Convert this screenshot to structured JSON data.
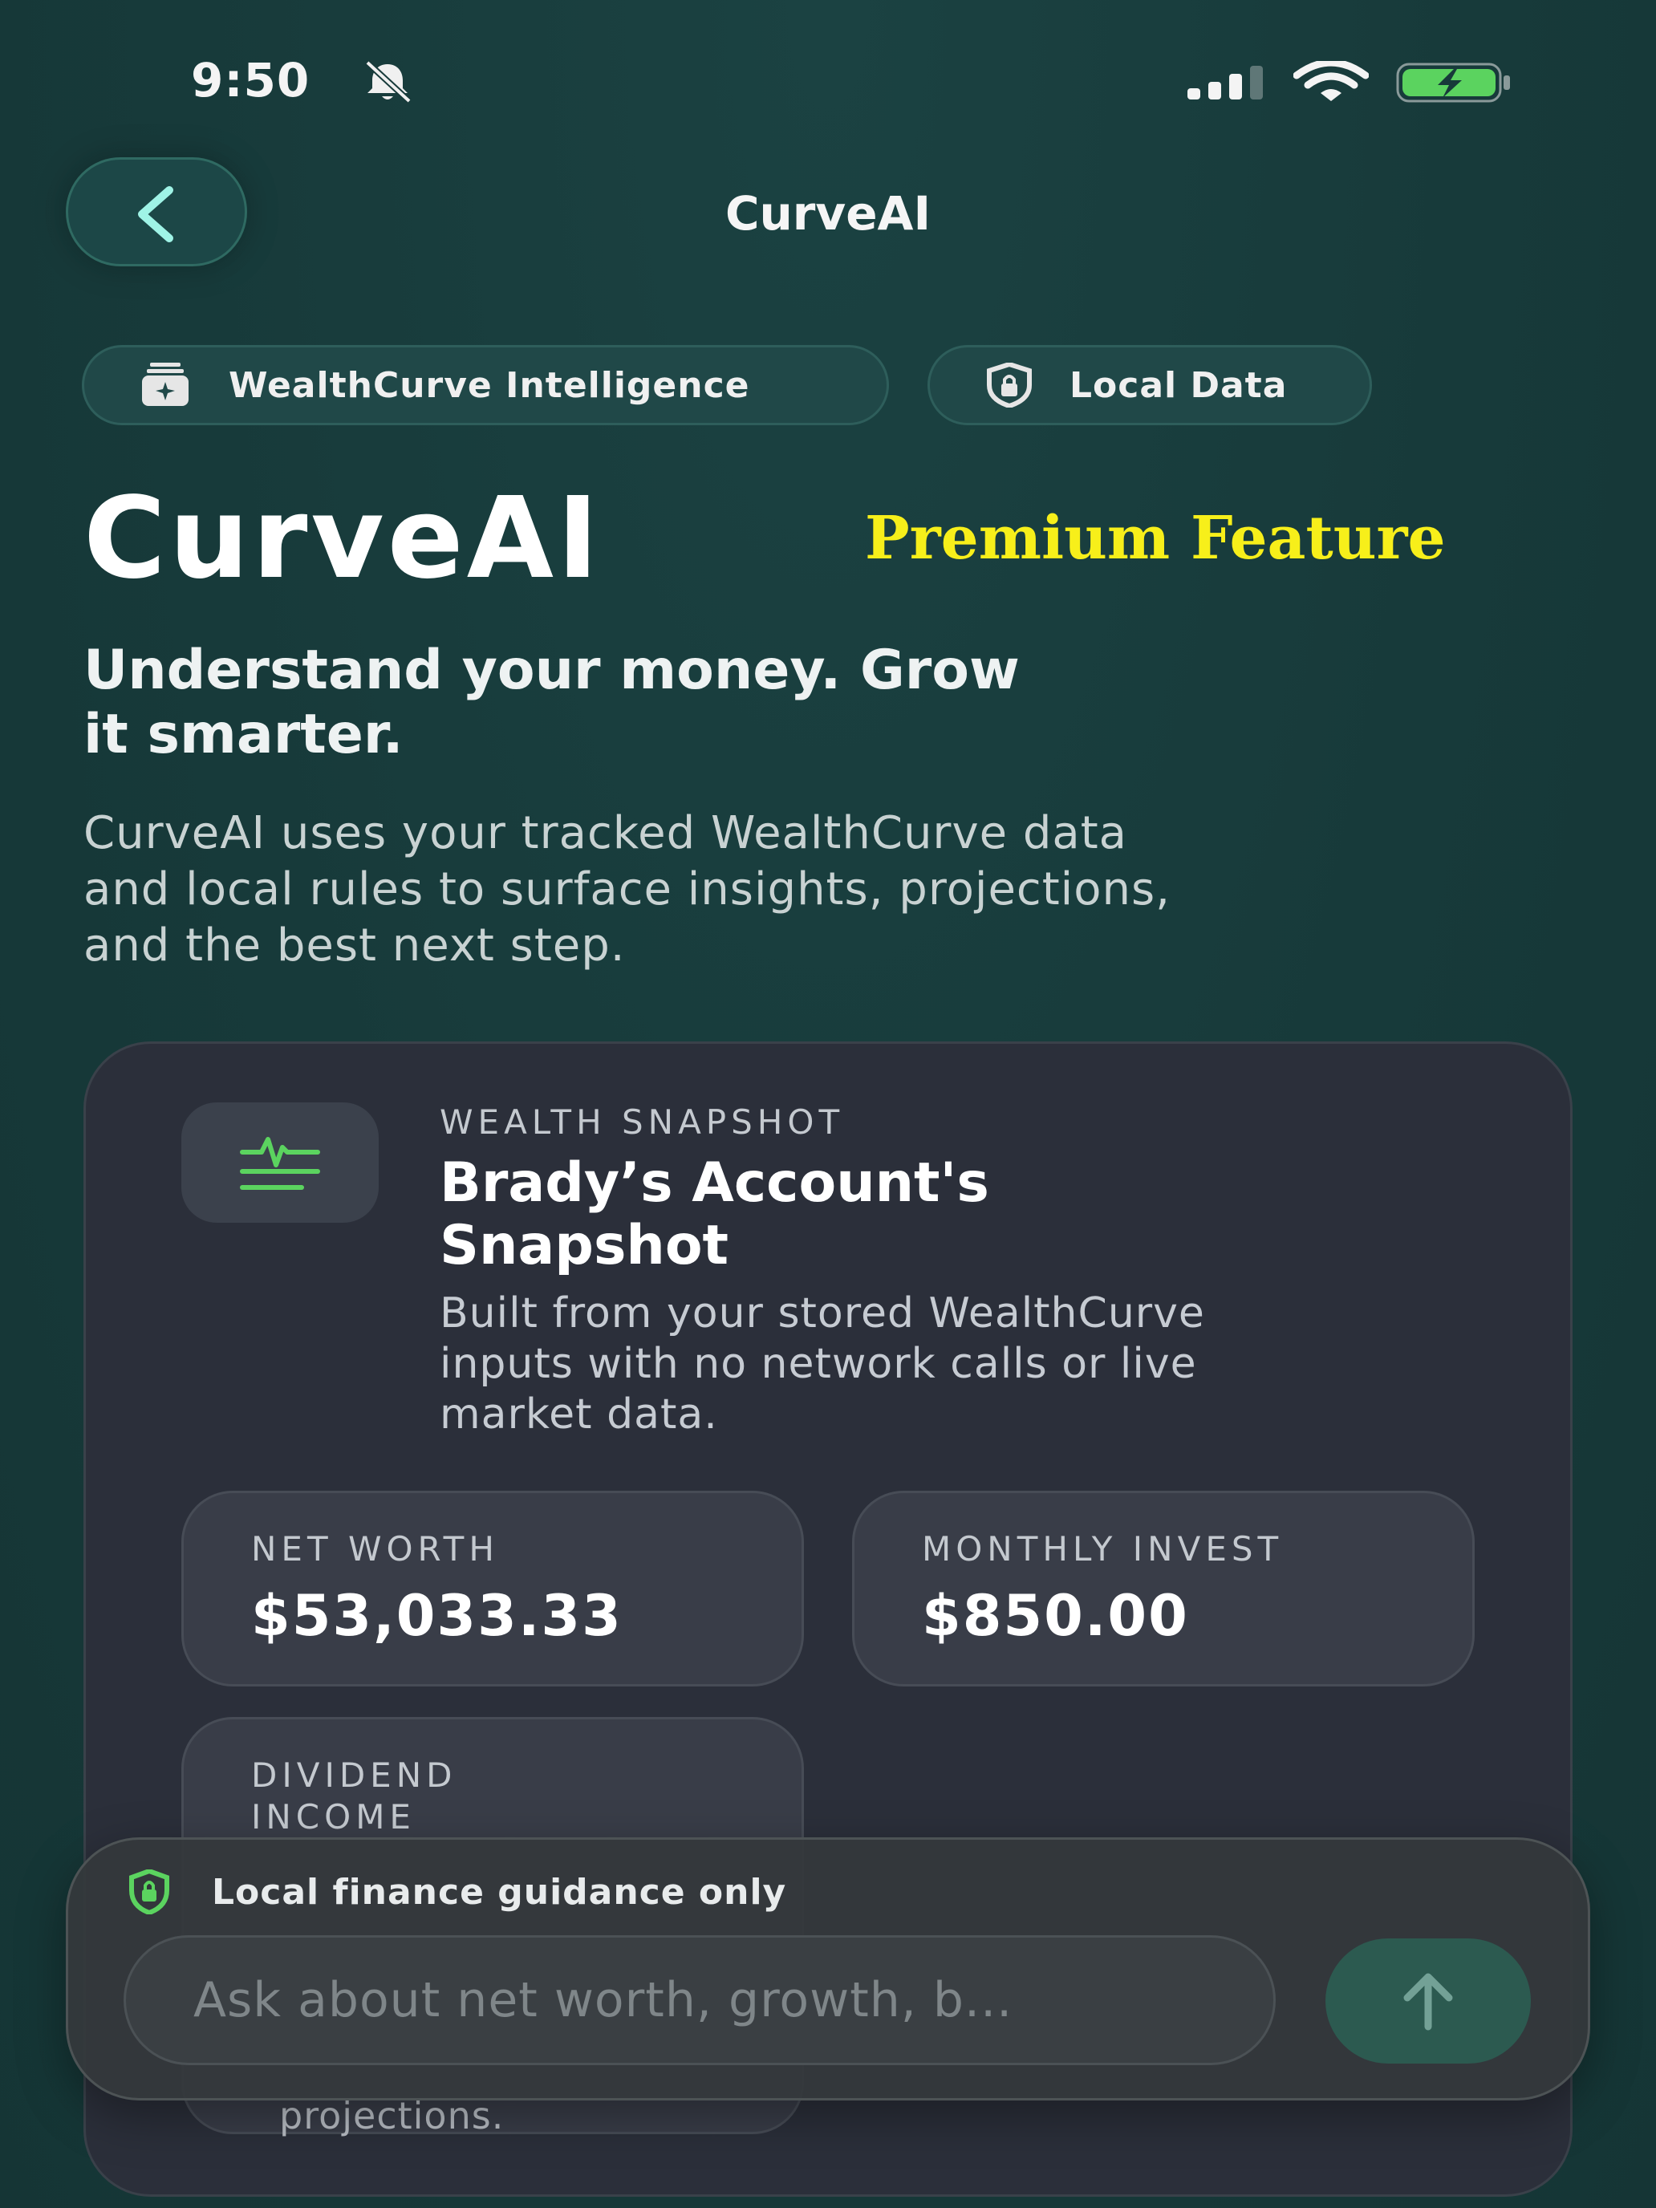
{
  "status_bar": {
    "time": "9:50"
  },
  "nav": {
    "title": "CurveAI"
  },
  "chips": [
    {
      "label": "WealthCurve Intelligence"
    },
    {
      "label": "Local Data"
    }
  ],
  "hero": {
    "title": "CurveAI",
    "badge": "Premium Feature",
    "headline_line1": "Understand your money. Grow",
    "headline_line2": "it smarter.",
    "description_line1": "CurveAI uses your tracked WealthCurve data",
    "description_line2": "and local rules to surface insights, projections,",
    "description_line3": "and the best next step."
  },
  "snapshot": {
    "eyebrow": "WEALTH SNAPSHOT",
    "title_line1": "Brady’s Account's",
    "title_line2": "Snapshot",
    "desc_line1": "Built from your stored WealthCurve",
    "desc_line2": "inputs with no network calls or live",
    "desc_line3": "market data.",
    "stats": [
      {
        "label": "NET WORTH",
        "value": "$53,033.33"
      },
      {
        "label": "MONTHLY INVEST",
        "value": "$850.00"
      },
      {
        "label": "DIVIDEND INCOME",
        "value": ""
      }
    ],
    "tail_text": "projections."
  },
  "composer": {
    "note": "Local finance guidance only",
    "placeholder": "Ask about net worth, growth, b..."
  },
  "colors": {
    "background": "#173a3a",
    "card": "#2b2f3a",
    "accent_green": "#5bd35f",
    "premium_yellow": "#f7ef1a"
  }
}
